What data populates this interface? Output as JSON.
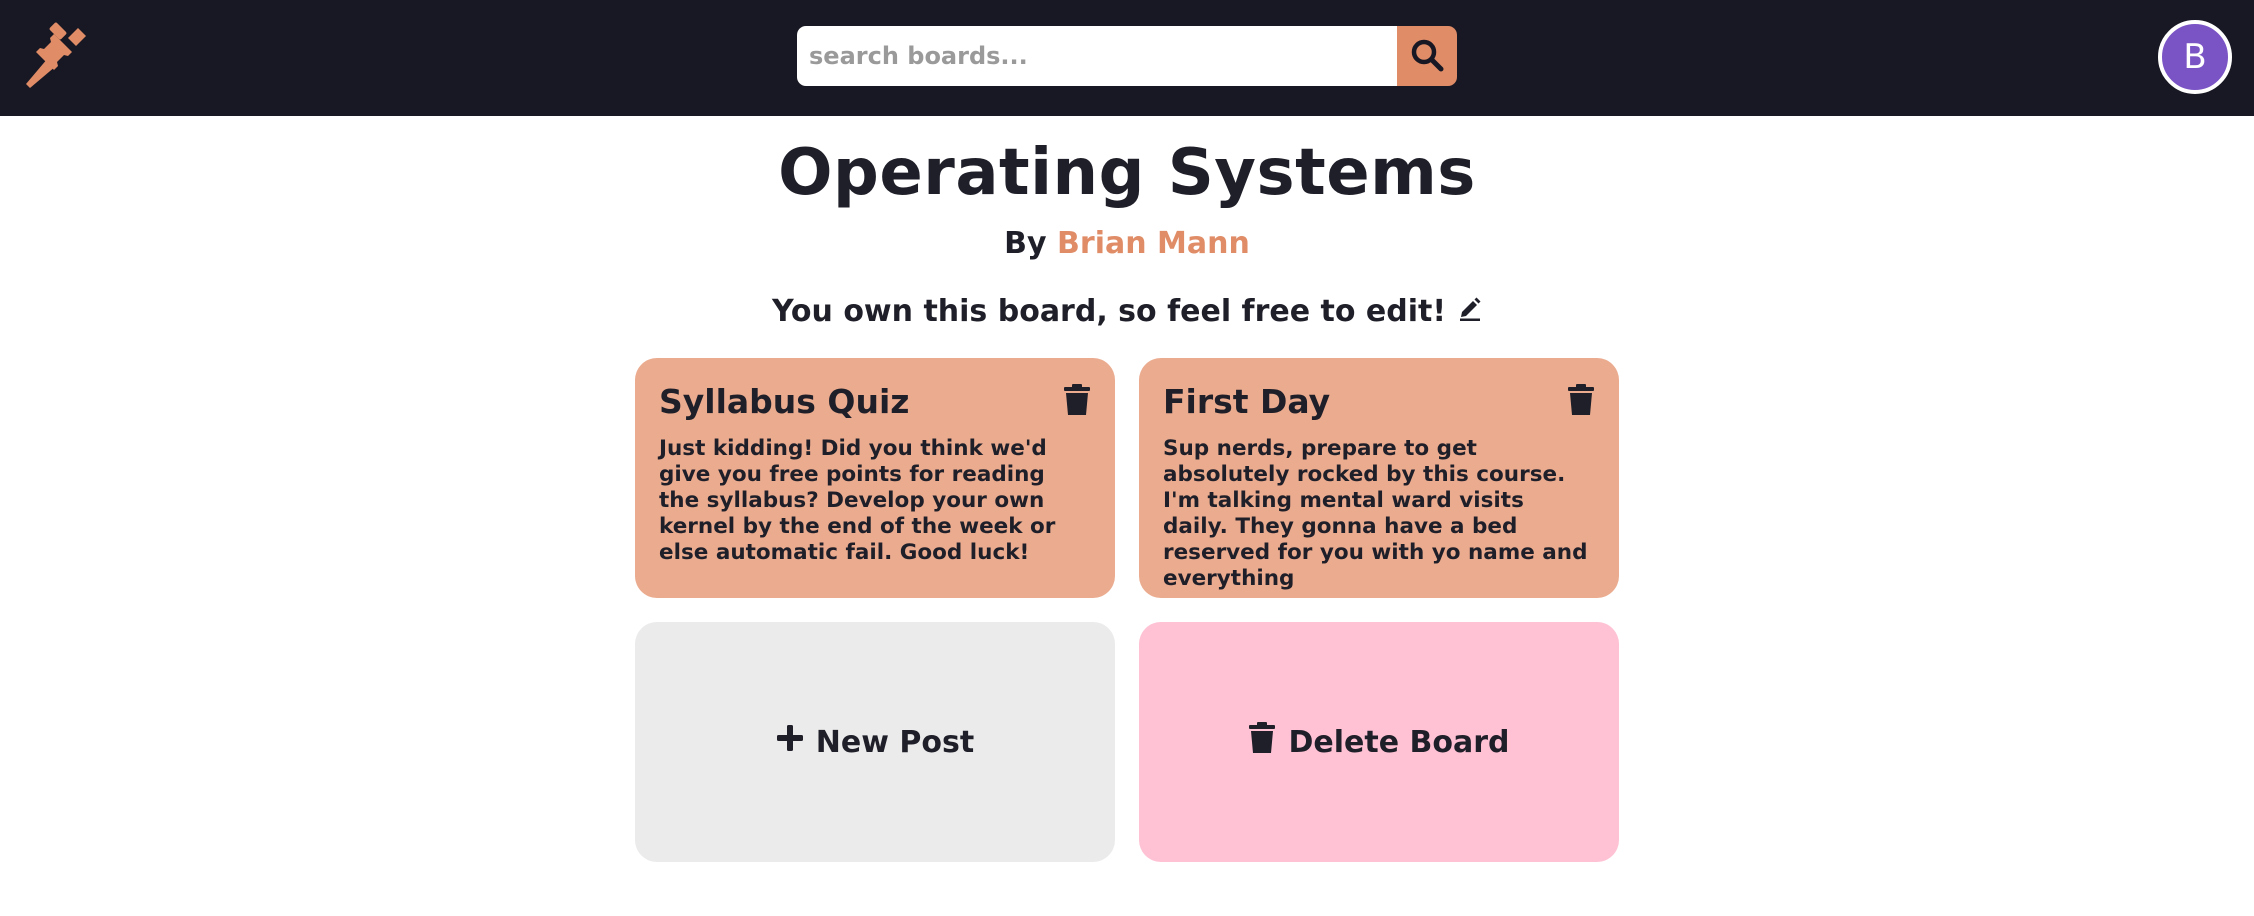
{
  "header": {
    "logo_icon": "pushpin-icon",
    "search": {
      "placeholder": "search boards...",
      "value": "",
      "icon": "search-icon"
    },
    "avatar": {
      "initial": "B",
      "color": "#7a53c5"
    },
    "background": "#181824",
    "accent": "#e08c67"
  },
  "board": {
    "title": "Operating Systems",
    "by_label": "By",
    "author": "Brian Mann",
    "owner_note": "You own this board, so feel free to edit!",
    "edit_icon": "pencil-icon"
  },
  "posts": [
    {
      "title": "Syllabus Quiz",
      "body": "Just kidding! Did you think we'd give you free points for reading the syllabus? Develop your own kernel by the end of the week or else automatic fail. Good luck!",
      "icon": "trash-icon",
      "color": "#ebab8f"
    },
    {
      "title": "First Day",
      "body": "Sup nerds, prepare to get absolutely rocked by this course. I'm talking mental ward visits daily. They gonna have a bed reserved for you with yo name and everything",
      "icon": "trash-icon",
      "color": "#ebab8f"
    }
  ],
  "actions": {
    "new_post": {
      "label": "New Post",
      "icon": "plus-icon",
      "color": "#ebebeb"
    },
    "delete_board": {
      "label": "Delete Board",
      "icon": "trash-icon",
      "color": "#ffc1d4"
    }
  }
}
